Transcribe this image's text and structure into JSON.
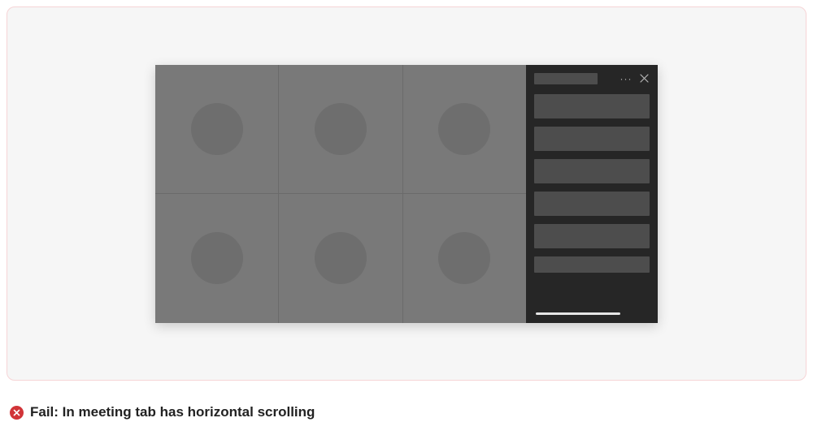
{
  "status": {
    "type": "fail",
    "label": "Fail: In meeting tab has horizontal scrolling"
  },
  "meeting": {
    "participant_count": 6,
    "side_panel": {
      "item_count": 6,
      "has_horizontal_scroll": true
    }
  },
  "colors": {
    "card_border": "#f6d4d6",
    "card_bg": "#f6f6f6",
    "window_bg": "#616161",
    "tile_bg": "#797979",
    "avatar_bg": "#6e6e6e",
    "panel_bg": "#262626",
    "panel_item_bg": "#4d4d4d",
    "fail_icon": "#d13438"
  },
  "icons": {
    "more": "···",
    "close": "×",
    "fail": "✕"
  }
}
